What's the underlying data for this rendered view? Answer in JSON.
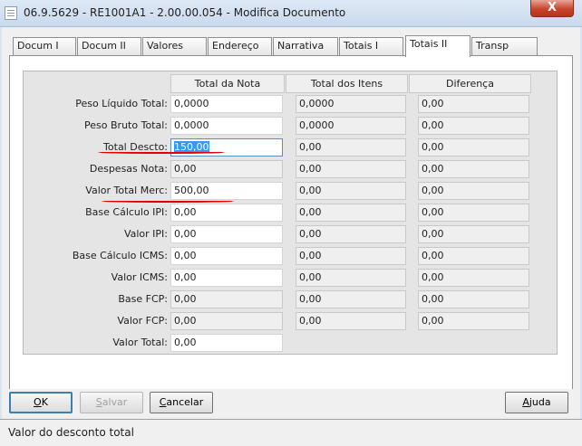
{
  "window": {
    "title": "06.9.5629 - RE1001A1 - 2.00.00.054 - Modifica Documento",
    "close_symbol": "X"
  },
  "tabs": [
    {
      "label": "Docum I"
    },
    {
      "label": "Docum II"
    },
    {
      "label": "Valores"
    },
    {
      "label": "Endereço"
    },
    {
      "label": "Narrativa"
    },
    {
      "label": "Totais I"
    },
    {
      "label": "Totais II",
      "active": true
    },
    {
      "label": "Transp"
    }
  ],
  "columns": {
    "nota": "Total da Nota",
    "itens": "Total dos Itens",
    "diferenca": "Diferença"
  },
  "rows": [
    {
      "label": "Peso Líquido Total:",
      "nota": "0,0000",
      "itens": "0,0000",
      "diferenca": "0,00"
    },
    {
      "label": "Peso Bruto Total:",
      "nota": "0,0000",
      "itens": "0,0000",
      "diferenca": "0,00"
    },
    {
      "label": "Total Descto:",
      "nota": "150,00",
      "itens": "0,00",
      "diferenca": "0,00"
    },
    {
      "label": "Despesas Nota:",
      "nota": "0,00",
      "itens": "0,00",
      "diferenca": "0,00"
    },
    {
      "label": "Valor Total Merc:",
      "nota": "500,00",
      "itens": "0,00",
      "diferenca": "0,00"
    },
    {
      "label": "Base Cálculo IPI:",
      "nota": "0,00",
      "itens": "0,00",
      "diferenca": "0,00"
    },
    {
      "label": "Valor IPI:",
      "nota": "0,00",
      "itens": "0,00",
      "diferenca": "0,00"
    },
    {
      "label": "Base Cálculo ICMS:",
      "nota": "0,00",
      "itens": "0,00",
      "diferenca": "0,00"
    },
    {
      "label": "Valor ICMS:",
      "nota": "0,00",
      "itens": "0,00",
      "diferenca": "0,00"
    },
    {
      "label": "Base FCP:",
      "nota": "0,00",
      "itens": "0,00",
      "diferenca": "0,00"
    },
    {
      "label": "Valor FCP:",
      "nota": "0,00",
      "itens": "0,00",
      "diferenca": "0,00"
    },
    {
      "label": "Valor Total:",
      "nota": "0,00"
    }
  ],
  "buttons": {
    "ok": {
      "acc": "O",
      "rest": "K"
    },
    "salvar": {
      "acc": "S",
      "rest": "alvar"
    },
    "cancelar": {
      "acc": "C",
      "rest": "ancelar"
    },
    "ajuda": {
      "acc": "A",
      "rest": "juda"
    }
  },
  "status": "Valor do desconto total",
  "colors": {
    "annotation": "#e30000",
    "selection": "#3399ff"
  }
}
